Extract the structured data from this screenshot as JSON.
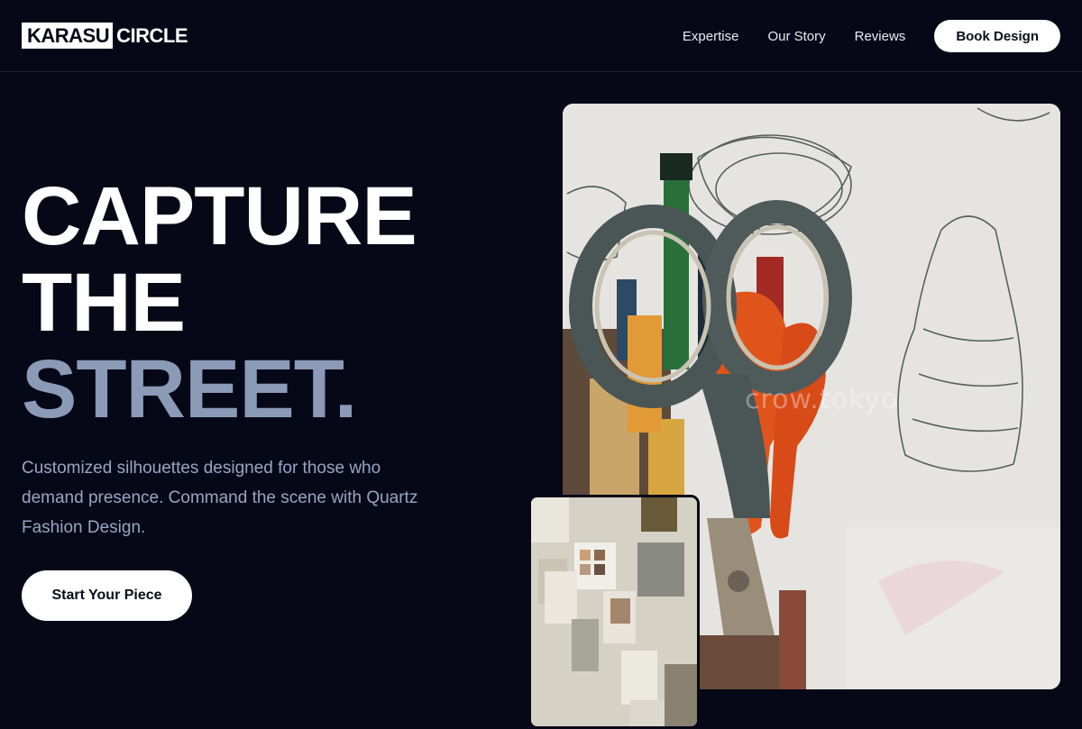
{
  "brand": {
    "logo_box": "KARASU",
    "logo_text": "CIRCLE"
  },
  "nav": {
    "items": [
      "Expertise",
      "Our Story",
      "Reviews"
    ],
    "cta": "Book Design"
  },
  "hero": {
    "line1": "CAPTURE",
    "line2": "THE",
    "line3": "STREET.",
    "description": "Customized silhouettes designed for those who demand presence. Command the scene with Quartz Fashion Design.",
    "cta": "Start Your Piece"
  },
  "images": {
    "main_watermark": "crow.tokyo",
    "main_icon": "scissors-photo",
    "inset_icon": "moodboard-photo"
  },
  "colors": {
    "background": "#060817",
    "accent": "#8b9ab6",
    "text": "#ffffff",
    "muted": "#9aa4c2"
  }
}
